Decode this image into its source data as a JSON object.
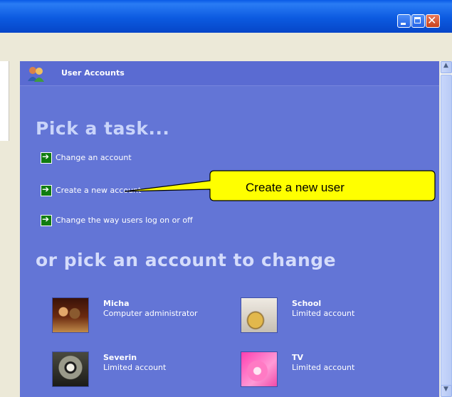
{
  "window": {
    "controls": [
      "minimize-icon",
      "maximize-icon",
      "close-icon"
    ]
  },
  "panel": {
    "header_title": "User Accounts",
    "header_icon": "users-icon",
    "pick_task_heading": "Pick a task...",
    "tasks": [
      {
        "label": "Change an account",
        "icon": "green-arrow-icon"
      },
      {
        "label": "Create a new account",
        "icon": "green-arrow-icon"
      },
      {
        "label": "Change the way users log on or off",
        "icon": "green-arrow-icon"
      }
    ],
    "pick_account_heading": "or pick an account to change",
    "accounts": [
      {
        "name": "Micha",
        "type": "Computer administrator",
        "picture": "chess-icon"
      },
      {
        "name": "School",
        "type": "Limited account",
        "picture": "guitar-icon"
      },
      {
        "name": "Severin",
        "type": "Limited account",
        "picture": "cat-icon"
      },
      {
        "name": "TV",
        "type": "Limited account",
        "picture": "flower-icon"
      }
    ]
  },
  "callout": {
    "text": "Create a new user"
  },
  "colors": {
    "panel_blue": "#6375d6",
    "title_blue": "#0a5be6",
    "callout_yellow": "#ffff00",
    "task_arrow_green": "#107c10"
  }
}
